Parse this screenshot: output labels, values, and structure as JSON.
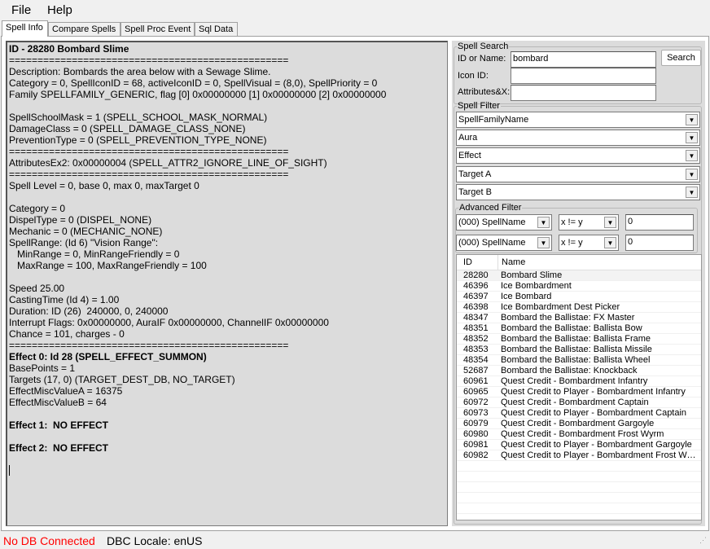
{
  "menu": {
    "file": "File",
    "help": "Help"
  },
  "tabs": [
    "Spell Info",
    "Compare Spells",
    "Spell Proc Event",
    "Sql Data"
  ],
  "spell_info": {
    "lines": [
      {
        "t": "ID - 28280 Bombard Slime",
        "b": true
      },
      {
        "t": "================================================="
      },
      {
        "t": "Description: Bombards the area below with a Sewage Slime."
      },
      {
        "t": "Category = 0, SpellIconID = 68, activeIconID = 0, SpellVisual = (8,0), SpellPriority = 0"
      },
      {
        "t": "Family SPELLFAMILY_GENERIC, flag [0] 0x00000000 [1] 0x00000000 [2] 0x00000000"
      },
      {
        "t": ""
      },
      {
        "t": "SpellSchoolMask = 1 (SPELL_SCHOOL_MASK_NORMAL)"
      },
      {
        "t": "DamageClass = 0 (SPELL_DAMAGE_CLASS_NONE)"
      },
      {
        "t": "PreventionType = 0 (SPELL_PREVENTION_TYPE_NONE)"
      },
      {
        "t": "================================================="
      },
      {
        "t": "AttributesEx2: 0x00000004 (SPELL_ATTR2_IGNORE_LINE_OF_SIGHT)"
      },
      {
        "t": "================================================="
      },
      {
        "t": "Spell Level = 0, base 0, max 0, maxTarget 0"
      },
      {
        "t": ""
      },
      {
        "t": "Category = 0"
      },
      {
        "t": "DispelType = 0 (DISPEL_NONE)"
      },
      {
        "t": "Mechanic = 0 (MECHANIC_NONE)"
      },
      {
        "t": "SpellRange: (Id 6) \"Vision Range\":"
      },
      {
        "t": "   MinRange = 0, MinRangeFriendly = 0"
      },
      {
        "t": "   MaxRange = 100, MaxRangeFriendly = 100"
      },
      {
        "t": ""
      },
      {
        "t": "Speed 25.00"
      },
      {
        "t": "CastingTime (Id 4) = 1.00"
      },
      {
        "t": "Duration: ID (26)  240000, 0, 240000"
      },
      {
        "t": "Interrupt Flags: 0x00000000, AuraIF 0x00000000, ChannelIF 0x00000000"
      },
      {
        "t": "Chance = 101, charges - 0"
      },
      {
        "t": "================================================="
      },
      {
        "t": "Effect 0: Id 28 (SPELL_EFFECT_SUMMON)",
        "b": true
      },
      {
        "t": "BasePoints = 1"
      },
      {
        "t": "Targets (17, 0) (TARGET_DEST_DB, NO_TARGET)"
      },
      {
        "t": "EffectMiscValueA = 16375"
      },
      {
        "t": "EffectMiscValueB = 64"
      },
      {
        "t": ""
      },
      {
        "t": "Effect 1:  NO EFFECT",
        "b": true
      },
      {
        "t": ""
      },
      {
        "t": "Effect 2:  NO EFFECT",
        "b": true
      }
    ]
  },
  "search": {
    "legend": "Spell Search",
    "id_label": "ID or Name:",
    "id_value": "bombard",
    "icon_label": "Icon ID:",
    "icon_value": "",
    "attr_label": "Attributes&X:",
    "attr_value": "",
    "button": "Search"
  },
  "filter": {
    "legend": "Spell Filter",
    "selects": [
      "SpellFamilyName",
      "Aura",
      "Effect",
      "Target A",
      "Target B"
    ]
  },
  "advanced": {
    "legend": "Advanced Filter",
    "rows": [
      {
        "field": "(000) SpellName",
        "op": "x != y",
        "value": "0"
      },
      {
        "field": "(000) SpellName",
        "op": "x != y",
        "value": "0"
      }
    ]
  },
  "results": {
    "headers": [
      "ID",
      "Name"
    ],
    "rows": [
      [
        "28280",
        "Bombard Slime"
      ],
      [
        "46396",
        "Ice Bombardment"
      ],
      [
        "46397",
        "Ice Bombard"
      ],
      [
        "46398",
        "Ice Bombardment Dest Picker"
      ],
      [
        "48347",
        "Bombard the Ballistae: FX Master"
      ],
      [
        "48351",
        "Bombard the Ballistae: Ballista Bow"
      ],
      [
        "48352",
        "Bombard the Ballistae: Ballista Frame"
      ],
      [
        "48353",
        "Bombard the Ballistae: Ballista Missile"
      ],
      [
        "48354",
        "Bombard the Ballistae: Ballista Wheel"
      ],
      [
        "52687",
        "Bombard the Ballistae: Knockback"
      ],
      [
        "60961",
        "Quest Credit - Bombardment Infantry"
      ],
      [
        "60965",
        "Quest Credit to Player - Bombardment Infantry"
      ],
      [
        "60972",
        "Quest Credit - Bombardment Captain"
      ],
      [
        "60973",
        "Quest Credit to Player - Bombardment Captain"
      ],
      [
        "60979",
        "Quest Credit - Bombardment Gargoyle"
      ],
      [
        "60980",
        "Quest Credit - Bombardment Frost Wyrm"
      ],
      [
        "60981",
        "Quest Credit to Player - Bombardment Gargoyle"
      ],
      [
        "60982",
        "Quest Credit to Player - Bombardment Frost Wyrm"
      ]
    ]
  },
  "status": {
    "db": "No DB Connected",
    "locale": "DBC Locale: enUS",
    "db_color": "#ff0000"
  }
}
